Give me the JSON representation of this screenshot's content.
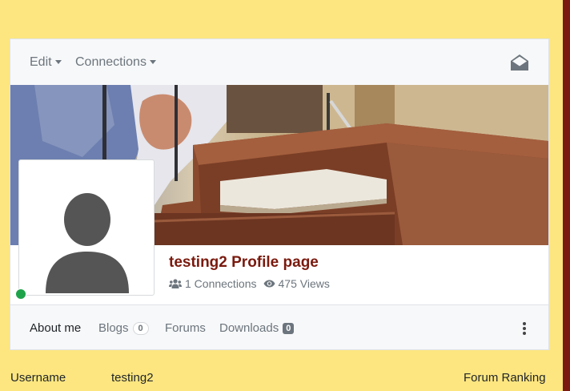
{
  "topbar": {
    "edit_label": "Edit",
    "connections_label": "Connections",
    "mail_icon": "envelope-open-icon"
  },
  "profile": {
    "title": "testing2 Profile page",
    "connections_text": "1 Connections",
    "views_text": "475 Views",
    "online_status_color": "#1fa34a"
  },
  "tabs": [
    {
      "label": "About me",
      "active": true
    },
    {
      "label": "Blogs",
      "count": "0"
    },
    {
      "label": "Forums"
    },
    {
      "label": "Downloads",
      "count": "0"
    }
  ],
  "below": {
    "username_label": "Username",
    "username_value": "testing2",
    "forum_ranking_label": "Forum Ranking"
  },
  "colors": {
    "page_background": "#fde680",
    "title_color": "#7a1a0e",
    "right_border": "#7b1a10"
  }
}
